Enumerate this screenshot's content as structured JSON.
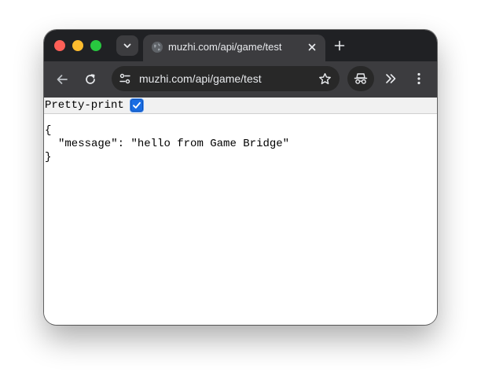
{
  "tab": {
    "title": "muzhi.com/api/game/test",
    "close_glyph": "✕",
    "new_tab_glyph": "+"
  },
  "toolbar": {
    "url": "muzhi.com/api/game/test"
  },
  "pretty_print": {
    "label": "Pretty-print",
    "checked": true
  },
  "json": {
    "open_brace": "{",
    "key": "\"message\"",
    "colon": ": ",
    "value": "\"hello from Game Bridge\"",
    "close_brace": "}"
  },
  "colors": {
    "tab_strip": "#202124",
    "toolbar": "#3c3c3f",
    "omnibox": "#282828",
    "checkbox_accent": "#1a6de3",
    "traffic_red": "#ff5f57",
    "traffic_yellow": "#febc2e",
    "traffic_green": "#28c840"
  },
  "icons": {
    "tab_search": "chevron-down-icon",
    "favicon": "globe-icon",
    "back": "arrow-left-icon",
    "reload": "reload-icon",
    "site_info": "tune-icon",
    "bookmark": "star-icon",
    "incognito": "incognito-icon",
    "extensions": "chevron-double-right-icon",
    "menu": "kebab-menu-icon"
  }
}
